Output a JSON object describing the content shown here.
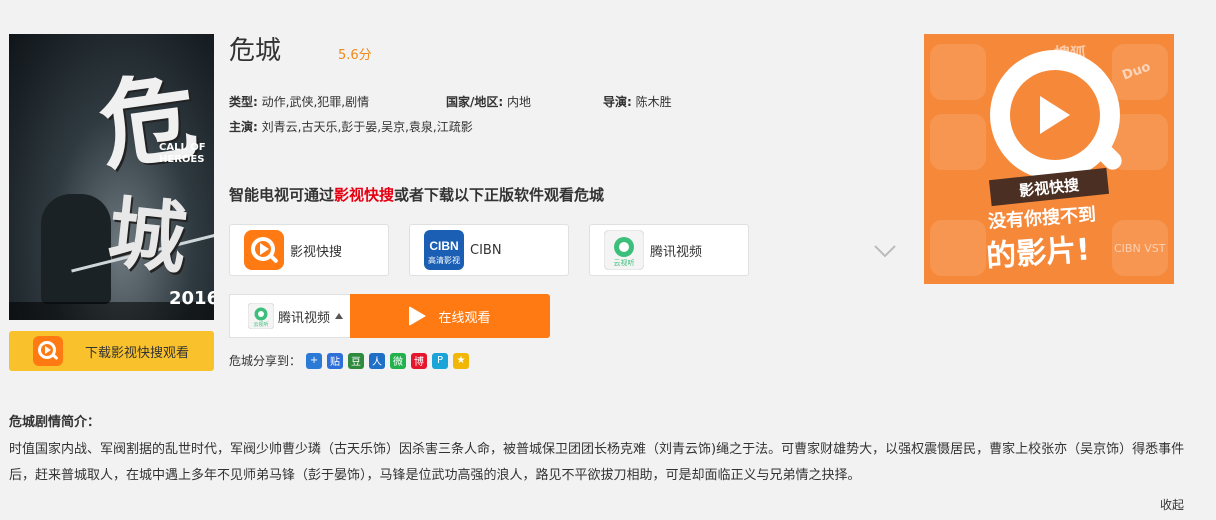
{
  "movie": {
    "title": "危城",
    "score": "5.6分",
    "poster": {
      "english_title": "CALL OF HEROES",
      "year": "2016"
    },
    "genre_label": "类型:",
    "genre_value": "动作,武侠,犯罪,剧情",
    "region_label": "国家/地区:",
    "region_value": "内地",
    "director_label": "导演:",
    "director_value": "陈木胜",
    "cast_label": "主演:",
    "cast_value": "刘青云,古天乐,彭于晏,吴京,袁泉,江疏影"
  },
  "download_button": {
    "label": "下载影视快搜观看",
    "icon": "yingshi-kuaisou-icon"
  },
  "hint": {
    "prefix": "智能电视可通过",
    "highlight": "影视快搜",
    "suffix": "或者下载以下正版软件观看危城"
  },
  "apps": [
    {
      "name": "影视快搜",
      "icon": "yingshi-kuaisou-icon"
    },
    {
      "name": "CIBN",
      "icon": "cibn-icon",
      "icon_text_top": "CIBN",
      "icon_text_bottom": "高清影视"
    },
    {
      "name": "腾讯视频",
      "icon": "tencent-video-icon",
      "icon_text": "云视听"
    }
  ],
  "source_select": {
    "selected": "腾讯视频",
    "icon": "tencent-video-icon",
    "icon_text": "云视听"
  },
  "play_button": {
    "label": "在线观看"
  },
  "share": {
    "label": "危城分享到：",
    "items": [
      "qzone-icon",
      "tieba-icon",
      "douban-icon",
      "renren-icon",
      "wechat-icon",
      "weibo-icon",
      "tencent-weibo-icon",
      "favorite-icon"
    ],
    "glyphs": [
      "+",
      "贴",
      "豆",
      "人",
      "微",
      "博",
      "P",
      "★"
    ]
  },
  "ad": {
    "banner": "影视快搜",
    "line1": "没有你搜不到",
    "line2": "的影片!",
    "tile_texts": [
      "搜狐",
      "Duo",
      "CIBN VST"
    ]
  },
  "synopsis": {
    "title": "危城剧情简介：",
    "body": "时值国家内战、军阀割据的乱世时代，军阀少帅曹少璘（古天乐饰）因杀害三条人命，被普城保卫团团长杨克难（刘青云饰)绳之于法。可曹家财雄势大，以强权震慑居民，曹家上校张亦（吴京饰）得悉事件后，赶来普城取人，在城中遇上多年不见师弟马锋（彭于晏饰），马锋是位武功高强的浪人，路见不平欲拔刀相助，可是却面临正义与兄弟情之抉择。"
  },
  "collapse_label": "收起",
  "colors": {
    "accent": "#ff7a12",
    "score": "#f08a1c",
    "highlight": "#e60012",
    "download_bg": "#f9c12b",
    "ad_bg": "#f6883a",
    "page_bg": "#f2f2f2"
  }
}
